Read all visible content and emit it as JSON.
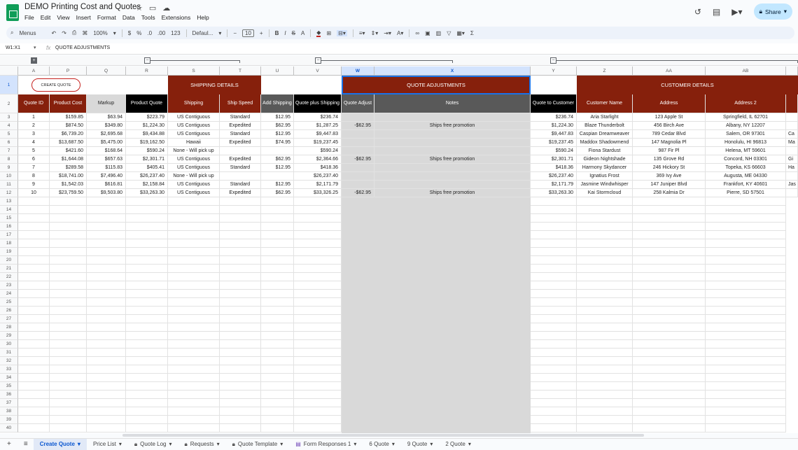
{
  "doc": {
    "title": "DEMO Printing Cost and Quotes",
    "menus": [
      "File",
      "Edit",
      "View",
      "Insert",
      "Format",
      "Data",
      "Tools",
      "Extensions",
      "Help"
    ],
    "share_label": "Share"
  },
  "toolbar": {
    "menus_label": "Menus",
    "zoom": "100%",
    "currency": "$",
    "percent": "%",
    "dec_less": ".0",
    "dec_more": ".00",
    "number_format": "123",
    "font": "Defaul...",
    "font_size": "10"
  },
  "formula": {
    "name_box": "W1:X1",
    "fx": "fx",
    "value": "QUOTE ADJUSTMENTS"
  },
  "columns": [
    "A",
    "P",
    "Q",
    "R",
    "S",
    "T",
    "U",
    "V",
    "W",
    "X",
    "Y",
    "Z",
    "AA",
    "AB"
  ],
  "row1": {
    "create_quote": "CREATE QUOTE",
    "shipping_details": "SHIPPING DETAILS",
    "quote_adjustments": "QUOTE ADJUSTMENTS",
    "customer_details": "CUSTOMER DETAILS"
  },
  "headers": [
    "Quote ID",
    "Product Cost",
    "Markup",
    "Product Quote",
    "Shipping",
    "Ship Speed",
    "Add Shipping",
    "Quote plus Shipping",
    "Quote Adjust",
    "Notes",
    "Quote to Customer",
    "Customer Name",
    "Address",
    "Address 2"
  ],
  "rows": [
    [
      "1",
      "$159.85",
      "$63.94",
      "$223.79",
      "US Contiguous",
      "Standard",
      "$12.95",
      "$236.74",
      "",
      "",
      "$236.74",
      "Aria Starlight",
      "123 Apple St",
      "Springfield, IL 62701"
    ],
    [
      "2",
      "$874.50",
      "$349.80",
      "$1,224.30",
      "US Contiguous",
      "Expedited",
      "$62.95",
      "$1,287.25",
      "-$62.95",
      "Ships free promotion",
      "$1,224.30",
      "Blaze Thunderbolt",
      "456 Birch Ave",
      "Albany, NY 12207"
    ],
    [
      "3",
      "$6,739.20",
      "$2,695.68",
      "$9,434.88",
      "US Contiguous",
      "Standard",
      "$12.95",
      "$9,447.83",
      "",
      "",
      "$9,447.83",
      "Caspian Dreamweaver",
      "789 Cedar Blvd",
      "Salem, OR 97301"
    ],
    [
      "4",
      "$13,687.50",
      "$5,475.00",
      "$19,162.50",
      "Hawaii",
      "Expedited",
      "$74.95",
      "$19,237.45",
      "",
      "",
      "$19,237.45",
      "Maddox Shadowmend",
      "147 Magnolia Pl",
      "Honolulu, HI 96813"
    ],
    [
      "5",
      "$421.60",
      "$168.64",
      "$590.24",
      "None - Will pick up",
      "",
      "",
      "$590.24",
      "",
      "",
      "$590.24",
      "Fiona Stardust",
      "987 Fir Pl",
      "Helena, MT 59601"
    ],
    [
      "6",
      "$1,644.08",
      "$657.63",
      "$2,301.71",
      "US Contiguous",
      "Expedited",
      "$62.95",
      "$2,364.66",
      "-$62.95",
      "Ships free promotion",
      "$2,301.71",
      "Gideon Nightshade",
      "135 Grove Rd",
      "Concord, NH 03301"
    ],
    [
      "7",
      "$289.58",
      "$115.83",
      "$405.41",
      "US Contiguous",
      "Standard",
      "$12.95",
      "$418.36",
      "",
      "",
      "$418.36",
      "Harmony Skydancer",
      "246 Hickory St",
      "Topeka, KS 66603"
    ],
    [
      "8",
      "$18,741.00",
      "$7,496.40",
      "$26,237.40",
      "None - Will pick up",
      "",
      "",
      "$26,237.40",
      "",
      "",
      "$26,237.40",
      "Ignatius Frost",
      "369 Ivy Ave",
      "Augusta, ME 04330"
    ],
    [
      "9",
      "$1,542.03",
      "$616.81",
      "$2,158.84",
      "US Contiguous",
      "Standard",
      "$12.95",
      "$2,171.79",
      "",
      "",
      "$2,171.79",
      "Jasmine Windwhisper",
      "147 Juniper Blvd",
      "Frankfort, KY 40601"
    ],
    [
      "10",
      "$23,759.50",
      "$9,503.80",
      "$33,263.30",
      "US Contiguous",
      "Expedited",
      "$62.95",
      "$33,326.25",
      "-$62.95",
      "Ships free promotion",
      "$33,263.30",
      "Kai Stormcloud",
      "258 Kalmia Dr",
      "Pierre, SD 57501"
    ]
  ],
  "overflow_text": [
    "",
    "",
    "Ca",
    "Ma",
    "",
    "Gi",
    "Ha",
    "",
    "Jas",
    ""
  ],
  "sheets": [
    {
      "label": "Create Quote",
      "active": true,
      "locked": false
    },
    {
      "label": "Price List",
      "active": false,
      "locked": false
    },
    {
      "label": "Quote Log",
      "active": false,
      "locked": true
    },
    {
      "label": "Requests",
      "active": false,
      "locked": true
    },
    {
      "label": "Quote Template",
      "active": false,
      "locked": true
    },
    {
      "label": "Form Responses 1",
      "active": false,
      "locked": false,
      "form": true
    },
    {
      "label": "6 Quote",
      "active": false,
      "locked": false
    },
    {
      "label": "9 Quote",
      "active": false,
      "locked": false
    },
    {
      "label": "2 Quote",
      "active": false,
      "locked": false
    }
  ],
  "colors": {
    "band": "#86200c",
    "header_gray": "#595959",
    "header_black": "#000000",
    "shaded": "#d9d9d9",
    "accent": "#0b57d0"
  }
}
